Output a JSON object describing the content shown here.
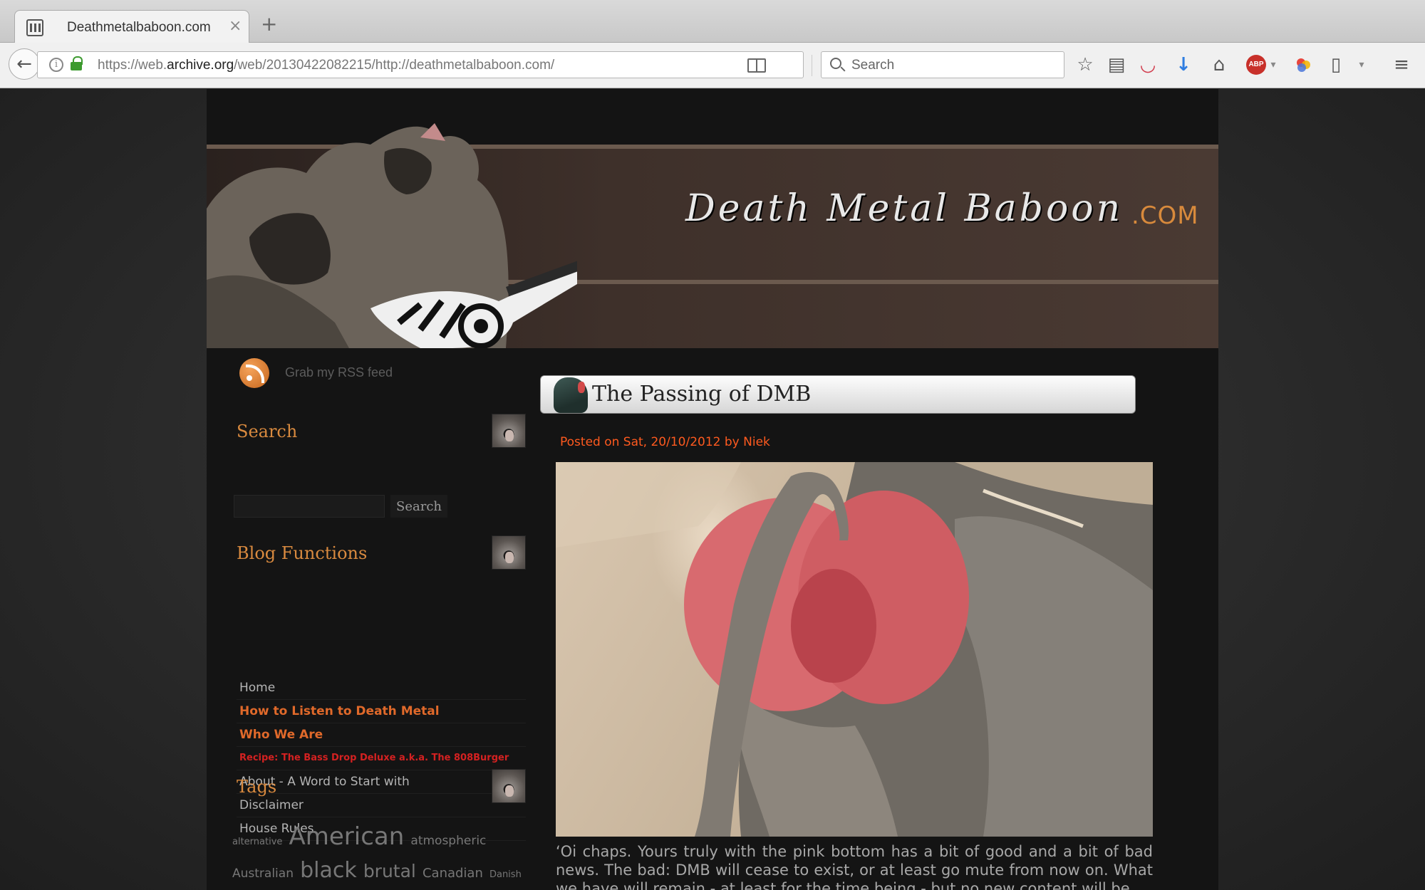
{
  "browser": {
    "tab_title": "Deathmetalbaboon.com",
    "tab_close": "×",
    "new_tab": "+",
    "url_prefix": "https://web.",
    "url_domain": "archive.org",
    "url_path": "/web/20130422082215/http://deathmetalbaboon.com/",
    "search_placeholder": "Search",
    "reload_glyph": "↻",
    "back_glyph": "←",
    "icons": {
      "bookmark_star": "☆",
      "reading_list": "▤",
      "pocket": "◡",
      "download": "↓",
      "home": "⌂",
      "adblock": "ABP",
      "dropdown": "▾",
      "clipboard": "▯",
      "menu": "≡"
    }
  },
  "site": {
    "logo_text": "Death Metal Baboon",
    "logo_tld": ".COM"
  },
  "sidebar": {
    "rss_label": "Grab my RSS feed",
    "search_title": "Search",
    "search_button": "Search",
    "blog_functions_title": "Blog Functions",
    "nav": [
      {
        "label": "Home",
        "style": "normal"
      },
      {
        "label": "How to Listen to Death Metal",
        "style": "orange"
      },
      {
        "label": "Who We Are",
        "style": "orange"
      },
      {
        "label": "Recipe: The Bass Drop Deluxe a.k.a. The 808Burger",
        "style": "red"
      },
      {
        "label": "About - A Word to Start with",
        "style": "normal"
      },
      {
        "label": "Disclaimer",
        "style": "normal"
      },
      {
        "label": "House Rules",
        "style": "normal"
      }
    ],
    "tags_title": "Tags",
    "tags": [
      {
        "label": "alternative",
        "size": 13
      },
      {
        "label": "American",
        "size": 34
      },
      {
        "label": "atmospheric",
        "size": 17
      },
      {
        "label": "Australian",
        "size": 17
      },
      {
        "label": "black",
        "size": 30
      },
      {
        "label": "brutal",
        "size": 25
      },
      {
        "label": "Canadian",
        "size": 18
      },
      {
        "label": "Danish",
        "size": 13
      }
    ]
  },
  "post": {
    "title": "The Passing of DMB",
    "meta": "Posted on Sat, 20/10/2012 by Niek",
    "body": "‘Oi chaps. Yours truly with the pink bottom has a bit of good and a bit of bad news. The bad: DMB will cease to exist, or at least go mute from now on. What we have will remain - at least for the time being - but no new content will be"
  },
  "colors": {
    "accent_orange": "#d98a3f",
    "link_orange": "#e0692a",
    "link_red": "#d42121",
    "meta_orange": "#ff5a1f"
  }
}
